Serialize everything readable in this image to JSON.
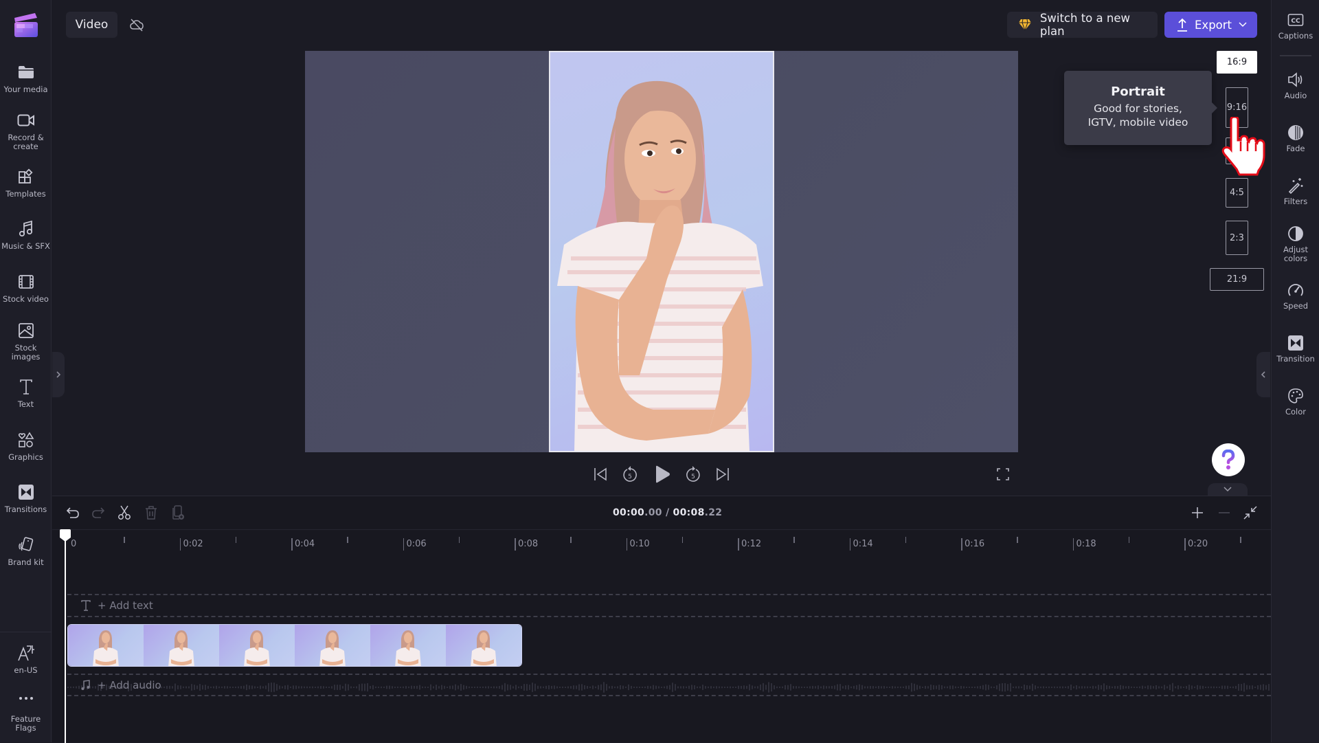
{
  "app": {
    "project_tab_label": "Video",
    "sync_status_icon": "cloud-off-icon"
  },
  "left_sidebar": {
    "items": [
      {
        "label": "Your media",
        "icon": "folder-icon"
      },
      {
        "label": "Record & create",
        "icon": "video-camera-icon"
      },
      {
        "label": "Templates",
        "icon": "templates-icon"
      },
      {
        "label": "Music & SFX",
        "icon": "music-note-icon"
      },
      {
        "label": "Stock video",
        "icon": "film-icon"
      },
      {
        "label": "Stock images",
        "icon": "image-icon"
      },
      {
        "label": "Text",
        "icon": "text-icon"
      },
      {
        "label": "Graphics",
        "icon": "shapes-icon"
      },
      {
        "label": "Transitions",
        "icon": "transition-icon"
      },
      {
        "label": "Brand kit",
        "icon": "brand-kit-icon"
      }
    ],
    "bottom_items": [
      {
        "label": "en-US",
        "icon": "language-icon"
      },
      {
        "label": "Feature Flags",
        "icon": "more-dots-icon"
      }
    ]
  },
  "header": {
    "plan_button_label": "Switch to a new plan",
    "export_button_label": "Export"
  },
  "right_sidebar": {
    "items": [
      {
        "label": "Captions",
        "icon": "captions-icon"
      },
      {
        "label": "Audio",
        "icon": "speaker-icon"
      },
      {
        "label": "Fade",
        "icon": "fade-icon"
      },
      {
        "label": "Filters",
        "icon": "magic-wand-icon"
      },
      {
        "label": "Adjust colors",
        "icon": "contrast-icon"
      },
      {
        "label": "Speed",
        "icon": "speedometer-icon"
      },
      {
        "label": "Transition",
        "icon": "transition-icon"
      },
      {
        "label": "Color",
        "icon": "palette-icon"
      }
    ]
  },
  "aspect_ratios": {
    "options": [
      "16:9",
      "9:16",
      "1:1",
      "4:5",
      "2:3",
      "21:9"
    ],
    "selected": "16:9",
    "hovered": "9:16"
  },
  "tooltip": {
    "title": "Portrait",
    "description_line1": "Good for stories,",
    "description_line2": "IGTV, mobile video"
  },
  "playback": {
    "skip_back_seconds": "5",
    "skip_forward_seconds": "5"
  },
  "timeline": {
    "current_time_main": "00:00",
    "current_time_frac": ".00",
    "separator": " / ",
    "duration_main": "00:08",
    "duration_frac": ".22",
    "ruler_labels": [
      "0",
      "0:02",
      "0:04",
      "0:06",
      "0:08",
      "0:10",
      "0:12",
      "0:14",
      "0:16",
      "0:18",
      "0:20"
    ],
    "add_text_label": "+ Add text",
    "add_audio_label": "+ Add audio",
    "clip_thumbnail_count": 6
  }
}
